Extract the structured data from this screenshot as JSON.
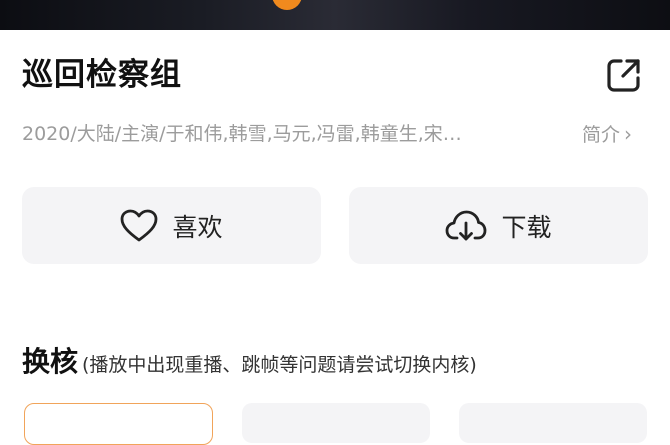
{
  "video": {
    "play_indicator_color": "#f08a1e"
  },
  "header": {
    "title": "巡回检察组",
    "share_icon": "share-icon"
  },
  "meta": {
    "info": "2020/大陆/主演/于和伟,韩雪,马元,冯雷,韩童生,宋…",
    "intro_label": "简介",
    "intro_chevron": "›"
  },
  "actions": {
    "like": {
      "label": "喜欢",
      "icon": "heart-icon"
    },
    "download": {
      "label": "下载",
      "icon": "download-icon"
    }
  },
  "core_section": {
    "title": "换核",
    "hint": "(播放中出现重播、跳帧等问题请尝试切换内核)",
    "options_visible": 3,
    "selected_index": 0,
    "accent": "#f1a45a"
  }
}
